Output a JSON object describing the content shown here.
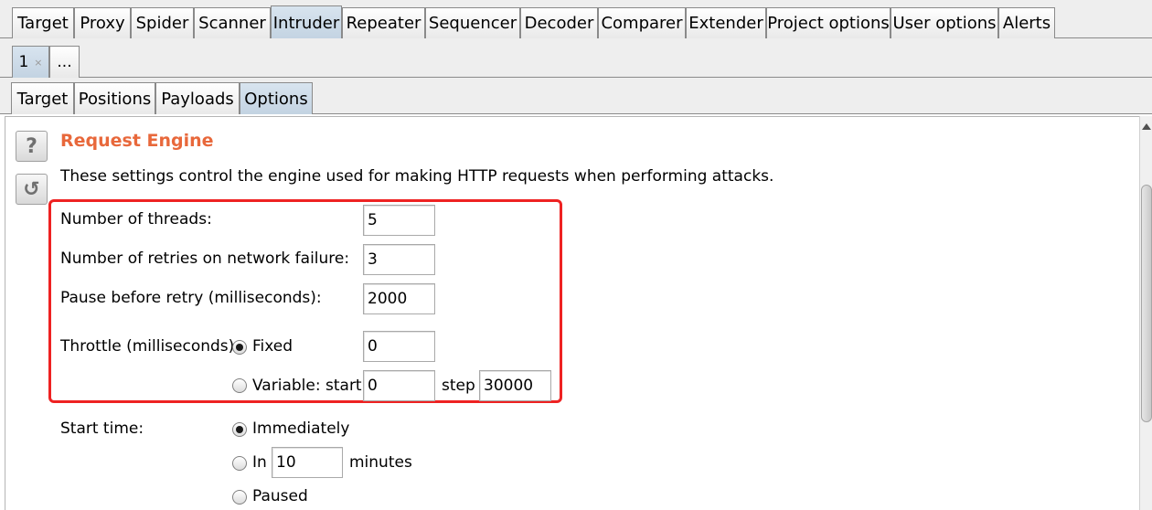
{
  "main_tabs": [
    {
      "label": "Target"
    },
    {
      "label": "Proxy"
    },
    {
      "label": "Spider"
    },
    {
      "label": "Scanner"
    },
    {
      "label": "Intruder",
      "active": true
    },
    {
      "label": "Repeater"
    },
    {
      "label": "Sequencer"
    },
    {
      "label": "Decoder"
    },
    {
      "label": "Comparer"
    },
    {
      "label": "Extender"
    },
    {
      "label": "Project options"
    },
    {
      "label": "User options"
    },
    {
      "label": "Alerts"
    }
  ],
  "attack_tabs": [
    {
      "label": "1",
      "close": "×",
      "active": true
    },
    {
      "label": "..."
    }
  ],
  "sub_tabs": [
    {
      "label": "Target"
    },
    {
      "label": "Positions"
    },
    {
      "label": "Payloads"
    },
    {
      "label": "Options",
      "active": true
    }
  ],
  "side_buttons": {
    "help_glyph": "?",
    "restore_glyph": "↺"
  },
  "section": {
    "title": "Request Engine",
    "description": "These settings control the engine used for making HTTP requests when performing attacks.",
    "title_color": "#e8683b"
  },
  "engine": {
    "threads_label": "Number of threads:",
    "threads_value": "5",
    "retries_label": "Number of retries on network failure:",
    "retries_value": "3",
    "pause_label": "Pause before retry (milliseconds):",
    "pause_value": "2000",
    "throttle_label": "Throttle (milliseconds):",
    "throttle_fixed_label": "Fixed",
    "throttle_fixed_checked": true,
    "throttle_fixed_value": "0",
    "throttle_variable_label": "Variable:",
    "throttle_start_label": "start",
    "throttle_start_value": "0",
    "throttle_step_label": "step",
    "throttle_step_value": "30000"
  },
  "start_time": {
    "label": "Start time:",
    "immediately_label": "Immediately",
    "immediately_checked": true,
    "in_label": "In",
    "in_value": "10",
    "minutes_label": "minutes",
    "paused_label": "Paused"
  },
  "colors": {
    "highlight": "#ee2222",
    "active_tab": "#c3d3e2"
  }
}
